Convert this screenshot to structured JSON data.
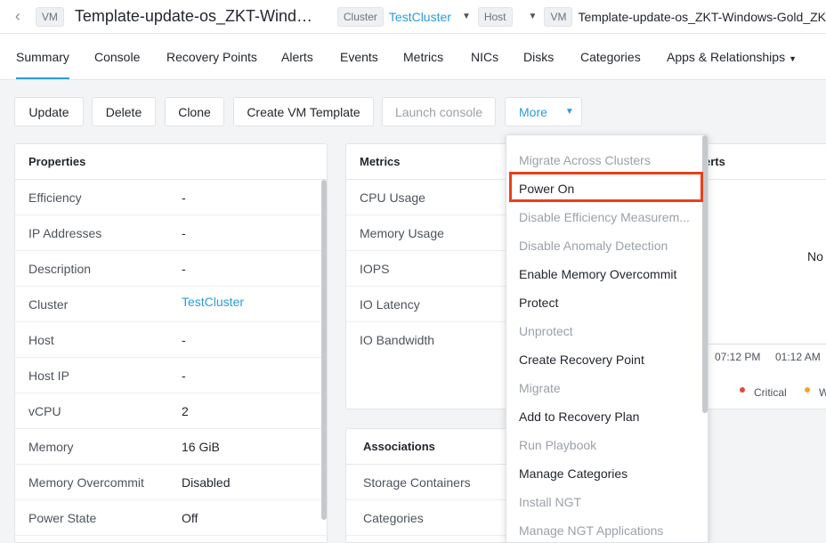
{
  "header": {
    "vm_badge": "VM",
    "title": "Template-update-os_ZKT-Windo...",
    "cluster_badge": "Cluster",
    "cluster_name": "TestCluster",
    "host_badge": "Host",
    "vm_badge_2": "VM",
    "vm_name_long": "Template-update-os_ZKT-Windows-Gold_ZK"
  },
  "tabs": [
    "Summary",
    "Console",
    "Recovery Points",
    "Alerts",
    "Events",
    "Metrics",
    "NICs",
    "Disks",
    "Categories",
    "Apps & Relationships"
  ],
  "actions": {
    "update": "Update",
    "delete": "Delete",
    "clone": "Clone",
    "create_template": "Create VM Template",
    "launch_console": "Launch console",
    "more": "More"
  },
  "properties": {
    "title": "Properties",
    "rows": [
      {
        "k": "Efficiency",
        "v": "-"
      },
      {
        "k": "IP Addresses",
        "v": "-"
      },
      {
        "k": "Description",
        "v": "-"
      },
      {
        "k": "Cluster",
        "v": "TestCluster"
      },
      {
        "k": "Host",
        "v": "-"
      },
      {
        "k": "Host IP",
        "v": "-"
      },
      {
        "k": "vCPU",
        "v": "2"
      },
      {
        "k": "Memory",
        "v": "16 GiB"
      },
      {
        "k": "Memory Overcommit",
        "v": "Disabled"
      },
      {
        "k": "Power State",
        "v": "Off"
      }
    ]
  },
  "metrics": {
    "title": "Metrics",
    "rows": [
      "CPU Usage",
      "Memory Usage",
      "IOPS",
      "IO Latency",
      "IO Bandwidth"
    ]
  },
  "associations": {
    "title": "Associations",
    "rows": [
      "Storage Containers",
      "Categories"
    ]
  },
  "alerts": {
    "title_partial": "erts",
    "no_text": "No",
    "time1": "07:12 PM",
    "time2": "01:12 AM",
    "legend_critical": "Critical",
    "legend_warning_partial": "W",
    "colors": {
      "critical": "#e4463b",
      "warning": "#f5a623"
    }
  },
  "more_menu": {
    "items": [
      {
        "label": "Migrate Across Clusters",
        "enabled": false
      },
      {
        "label": "Power On",
        "enabled": true
      },
      {
        "label": "Disable Efficiency Measurem...",
        "enabled": false
      },
      {
        "label": "Disable Anomaly Detection",
        "enabled": false
      },
      {
        "label": "Enable Memory Overcommit",
        "enabled": true
      },
      {
        "label": "Protect",
        "enabled": true
      },
      {
        "label": "Unprotect",
        "enabled": false
      },
      {
        "label": "Create Recovery Point",
        "enabled": true
      },
      {
        "label": "Migrate",
        "enabled": false
      },
      {
        "label": "Add to Recovery Plan",
        "enabled": true
      },
      {
        "label": "Run Playbook",
        "enabled": false
      },
      {
        "label": "Manage Categories",
        "enabled": true
      },
      {
        "label": "Install NGT",
        "enabled": false
      },
      {
        "label": "Manage NGT Applications",
        "enabled": false
      }
    ]
  }
}
